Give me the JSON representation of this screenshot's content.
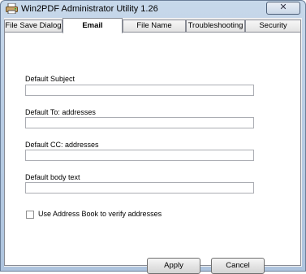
{
  "window": {
    "title": "Win2PDF Administrator Utility 1.26",
    "close_glyph": "✕"
  },
  "tabs": [
    {
      "label": "File Save Dialog"
    },
    {
      "label": "Email"
    },
    {
      "label": "File Name"
    },
    {
      "label": "Troubleshooting"
    },
    {
      "label": "Security"
    }
  ],
  "active_tab": "Email",
  "fields": {
    "subject": {
      "label": "Default Subject",
      "value": ""
    },
    "to": {
      "label": "Default To: addresses",
      "value": ""
    },
    "cc": {
      "label": "Default CC: addresses",
      "value": ""
    },
    "body": {
      "label": "Default body text",
      "value": ""
    }
  },
  "address_book": {
    "label": "Use Address Book to verify addresses",
    "checked": false
  },
  "buttons": {
    "apply": "Apply",
    "cancel": "Cancel"
  }
}
